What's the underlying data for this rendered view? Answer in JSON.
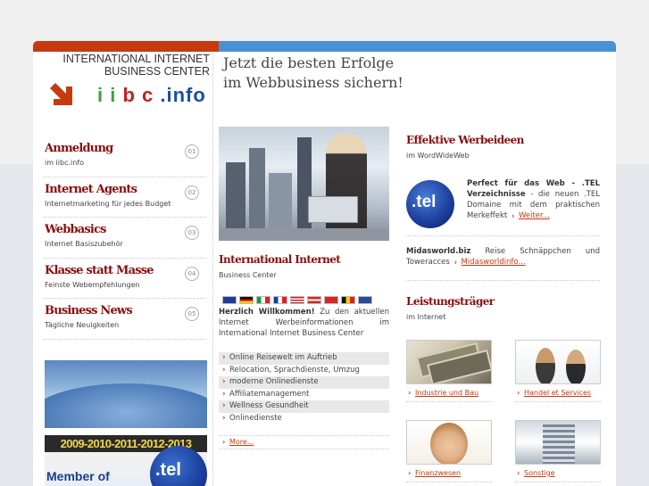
{
  "header": {
    "logo_line1": "INTERNATIONAL INTERNET",
    "logo_line2": "BUSINESS CENTER",
    "brand_part1": "i i",
    "brand_part2": "b c",
    "brand_part3": ".info",
    "slogan_line1": "Jetzt die besten Erfolge",
    "slogan_line2": "im Webbusiness sichern!"
  },
  "nav": [
    {
      "title": "Anmeldung",
      "sub": "im iibc.info",
      "num": "01"
    },
    {
      "title": "Internet Agents",
      "sub": "Internetmarketing für jedes Budget",
      "num": "02"
    },
    {
      "title": "Webbasics",
      "sub": "Internet Basiszubehör",
      "num": "03"
    },
    {
      "title": "Klasse statt Masse",
      "sub": "Feinste Webempfehlungen",
      "num": "04"
    },
    {
      "title": "Business News",
      "sub": "Tägliche Neuigkeiten",
      "num": "05"
    }
  ],
  "banner": {
    "years": "2009-2010-2011-2012-2013",
    "member": "Member of",
    "tel": ".tel"
  },
  "middle": {
    "title": "International Internet",
    "subtitle": "Business Center",
    "welcome_bold": "Herzlich Willkommen!",
    "welcome_text": " Zu den aktuellen Internet Werbeinformationen im International Internet Business Center",
    "links": [
      "Online Reisewelt im Auftrieb",
      "Relocation, Sprachdienste, Umzug",
      "moderne Onlinedienste",
      "Affiliatemanagement",
      "Wellness Gesundheit",
      "Onlinedienste"
    ],
    "more": "More..."
  },
  "right": {
    "title1": "Effektive Werbeideen",
    "sub1": "im WordWideWeb",
    "tel_logo": ".tel",
    "tel_bold": "Perfect für das Web - .TEL Verzeichnisse",
    "tel_text": " - die neuen .TEL Domaine mit dem praktischen Merkeffekt",
    "tel_more": "Weiter...",
    "mw_bold": "Midasworld.biz",
    "mw_text": " Reise Schnäppchen und Toweracces",
    "mw_more": "Midasworldinfo...",
    "title2": "Leistungsträger",
    "sub2": "im Internet",
    "captions": [
      "Industrie und Bau",
      "Handel et Services",
      "Finanzwesen",
      "Sonstige"
    ]
  },
  "colors": {
    "accent_red": "#c63a10",
    "accent_blue": "#4a90d4",
    "heading": "#8a0d0d"
  }
}
